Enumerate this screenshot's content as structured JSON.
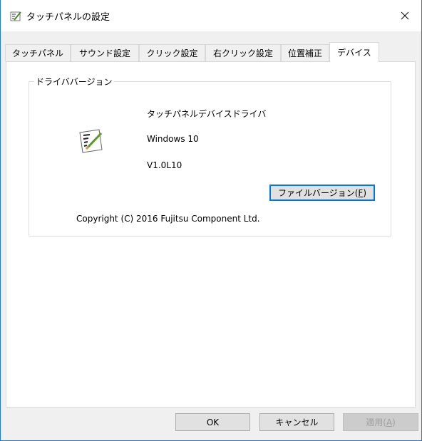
{
  "window": {
    "title": "タッチパネルの設定",
    "close_glyph": "✕"
  },
  "tabs": [
    {
      "label": "タッチパネル"
    },
    {
      "label": "サウンド設定"
    },
    {
      "label": "クリック設定"
    },
    {
      "label": "右クリック設定"
    },
    {
      "label": "位置補正"
    },
    {
      "label": "デバイス",
      "active": true
    }
  ],
  "driver_group": {
    "title": "ドライババージョン",
    "driver_name": "タッチパネルデバイスドライバ",
    "os": "Windows 10",
    "version": "V1.0L10",
    "file_version_button": {
      "label": "ファイルバージョン(",
      "mnemonic": "F",
      "suffix": ")"
    },
    "copyright": "Copyright (C) 2016 Fujitsu Component Ltd."
  },
  "buttons": {
    "ok": "OK",
    "cancel": "キャンセル",
    "apply": "適用(",
    "apply_mnemonic": "A",
    "apply_suffix": ")"
  }
}
